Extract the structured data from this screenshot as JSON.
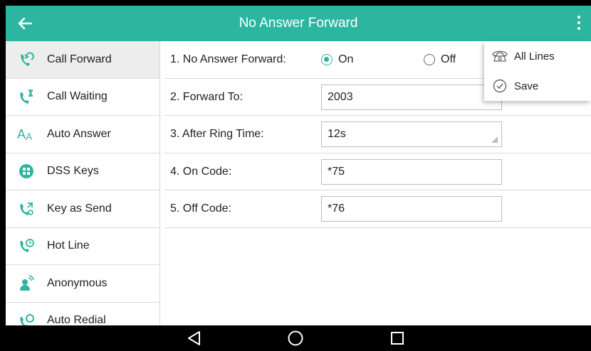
{
  "header": {
    "title": "No Answer Forward",
    "back_icon": "arrow-left-icon",
    "more_icon": "more-vertical-icon",
    "color": "#2cb6a0"
  },
  "sidebar": {
    "items": [
      {
        "label": "Call Forward",
        "icon": "call-forward-icon",
        "active": true
      },
      {
        "label": "Call Waiting",
        "icon": "call-waiting-icon",
        "active": false
      },
      {
        "label": "Auto Answer",
        "icon": "auto-answer-icon",
        "active": false
      },
      {
        "label": "DSS Keys",
        "icon": "dss-keys-icon",
        "active": false
      },
      {
        "label": "Key as Send",
        "icon": "key-as-send-icon",
        "active": false
      },
      {
        "label": "Hot Line",
        "icon": "hot-line-icon",
        "active": false
      },
      {
        "label": "Anonymous",
        "icon": "anonymous-icon",
        "active": false
      },
      {
        "label": "Auto Redial",
        "icon": "auto-redial-icon",
        "active": false
      }
    ]
  },
  "form": {
    "no_answer_forward": {
      "label": "1. No Answer Forward:",
      "on_label": "On",
      "off_label": "Off",
      "selected": "On"
    },
    "forward_to": {
      "label": "2. Forward To:",
      "value": "2003"
    },
    "after_ring_time": {
      "label": "3. After Ring Time:",
      "value": "12s"
    },
    "on_code": {
      "label": "4. On Code:",
      "value": "*75"
    },
    "off_code": {
      "label": "5. Off Code:",
      "value": "*76"
    }
  },
  "popup": {
    "items": [
      {
        "label": "All Lines",
        "icon": "phone-icon"
      },
      {
        "label": "Save",
        "icon": "check-circle-icon"
      }
    ]
  },
  "navbar": {
    "back_icon": "nav-back-triangle-icon",
    "home_icon": "nav-home-circle-icon",
    "recents_icon": "nav-recents-square-icon"
  }
}
